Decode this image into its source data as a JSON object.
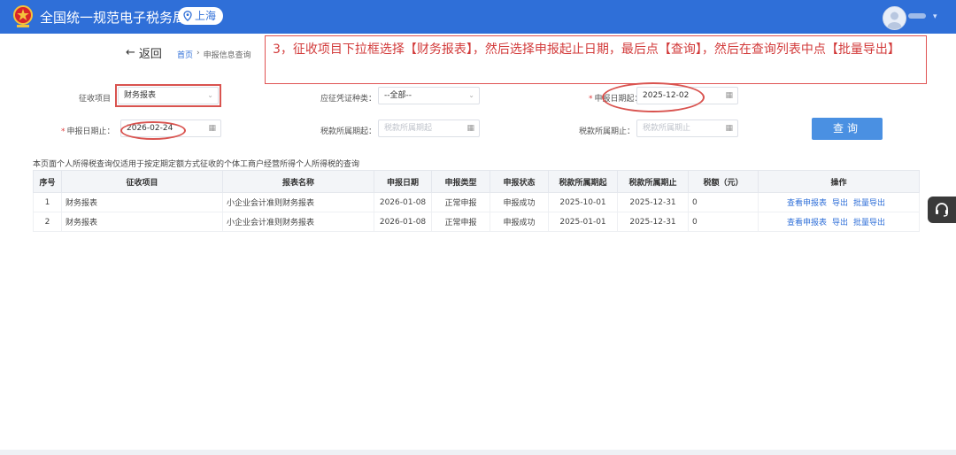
{
  "header": {
    "brand": "全国统一规范电子税务局",
    "location": "上海"
  },
  "nav": {
    "back": "返回",
    "breadcrumb_home": "首页",
    "breadcrumb_sep": "›",
    "breadcrumb_current": "申报信息查询"
  },
  "callout": {
    "text": "3，征收项目下拉框选择【财务报表】，然后选择申报起止日期，最后点【查询】，然后在查询列表中点【批量导出】"
  },
  "form": {
    "tax_item_label": "征收项目",
    "tax_item_value": "财务报表",
    "voucher_type_label": "应征凭证种类：",
    "voucher_type_value": "--全部--",
    "start_date_label": "申报日期起：",
    "start_date_value": "2025-12-02",
    "end_date_label": "申报日期止：",
    "end_date_value": "2026-02-24",
    "period_start_label": "税款所属期起：",
    "period_start_placeholder": "税款所属期起",
    "period_end_label": "税款所属期止：",
    "period_end_placeholder": "税款所属期止",
    "query_button": "查询"
  },
  "note": "本页面个人所得税查询仅适用于按定期定额方式征收的个体工商户经营所得个人所得税的查询",
  "table": {
    "headers": [
      "序号",
      "征收项目",
      "报表名称",
      "申报日期",
      "申报类型",
      "申报状态",
      "税款所属期起",
      "税款所属期止",
      "税额（元）",
      "操作"
    ],
    "rows": [
      {
        "no": "1",
        "item": "财务报表",
        "report": "小企业会计准则财务报表",
        "date": "2026-01-08",
        "type": "正常申报",
        "status": "申报成功",
        "start": "2025-10-01",
        "end": "2025-12-31",
        "tax": "0"
      },
      {
        "no": "2",
        "item": "财务报表",
        "report": "小企业会计准则财务报表",
        "date": "2026-01-08",
        "type": "正常申报",
        "status": "申报成功",
        "start": "2025-01-01",
        "end": "2025-12-31",
        "tax": "0"
      }
    ],
    "ops": {
      "view": "查看申报表",
      "export": "导出",
      "batch_export": "批量导出"
    }
  },
  "colors": {
    "header_bg": "#2f6fd8",
    "annotation_red": "#d9534f",
    "button_blue": "#4a90e2",
    "link_blue": "#2f6fd8"
  },
  "icons": [
    "national-emblem-icon",
    "location-pin-icon",
    "user-avatar-icon",
    "back-arrow-icon",
    "calendar-icon",
    "dropdown-arrow-icon",
    "headset-icon"
  ]
}
